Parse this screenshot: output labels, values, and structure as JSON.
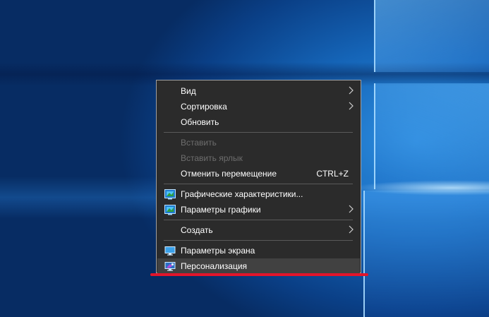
{
  "context_menu": {
    "items": [
      {
        "label": "Вид",
        "has_submenu": true
      },
      {
        "label": "Сортировка",
        "has_submenu": true
      },
      {
        "label": "Обновить"
      },
      {
        "label": "Вставить",
        "disabled": true
      },
      {
        "label": "Вставить ярлык",
        "disabled": true
      },
      {
        "label": "Отменить перемещение",
        "shortcut": "CTRL+Z"
      },
      {
        "label": "Графические характеристики...",
        "icon": "intel-graphics-icon"
      },
      {
        "label": "Параметры графики",
        "icon": "intel-graphics-icon",
        "has_submenu": true
      },
      {
        "label": "Создать",
        "has_submenu": true
      },
      {
        "label": "Параметры экрана",
        "icon": "display-settings-icon"
      },
      {
        "label": "Персонализация",
        "icon": "personalization-icon",
        "highlighted": true
      }
    ]
  },
  "colors": {
    "menu_bg": "#2b2b2b",
    "highlight_underline": "#e2152b",
    "disabled_text": "#6d6d6d"
  }
}
